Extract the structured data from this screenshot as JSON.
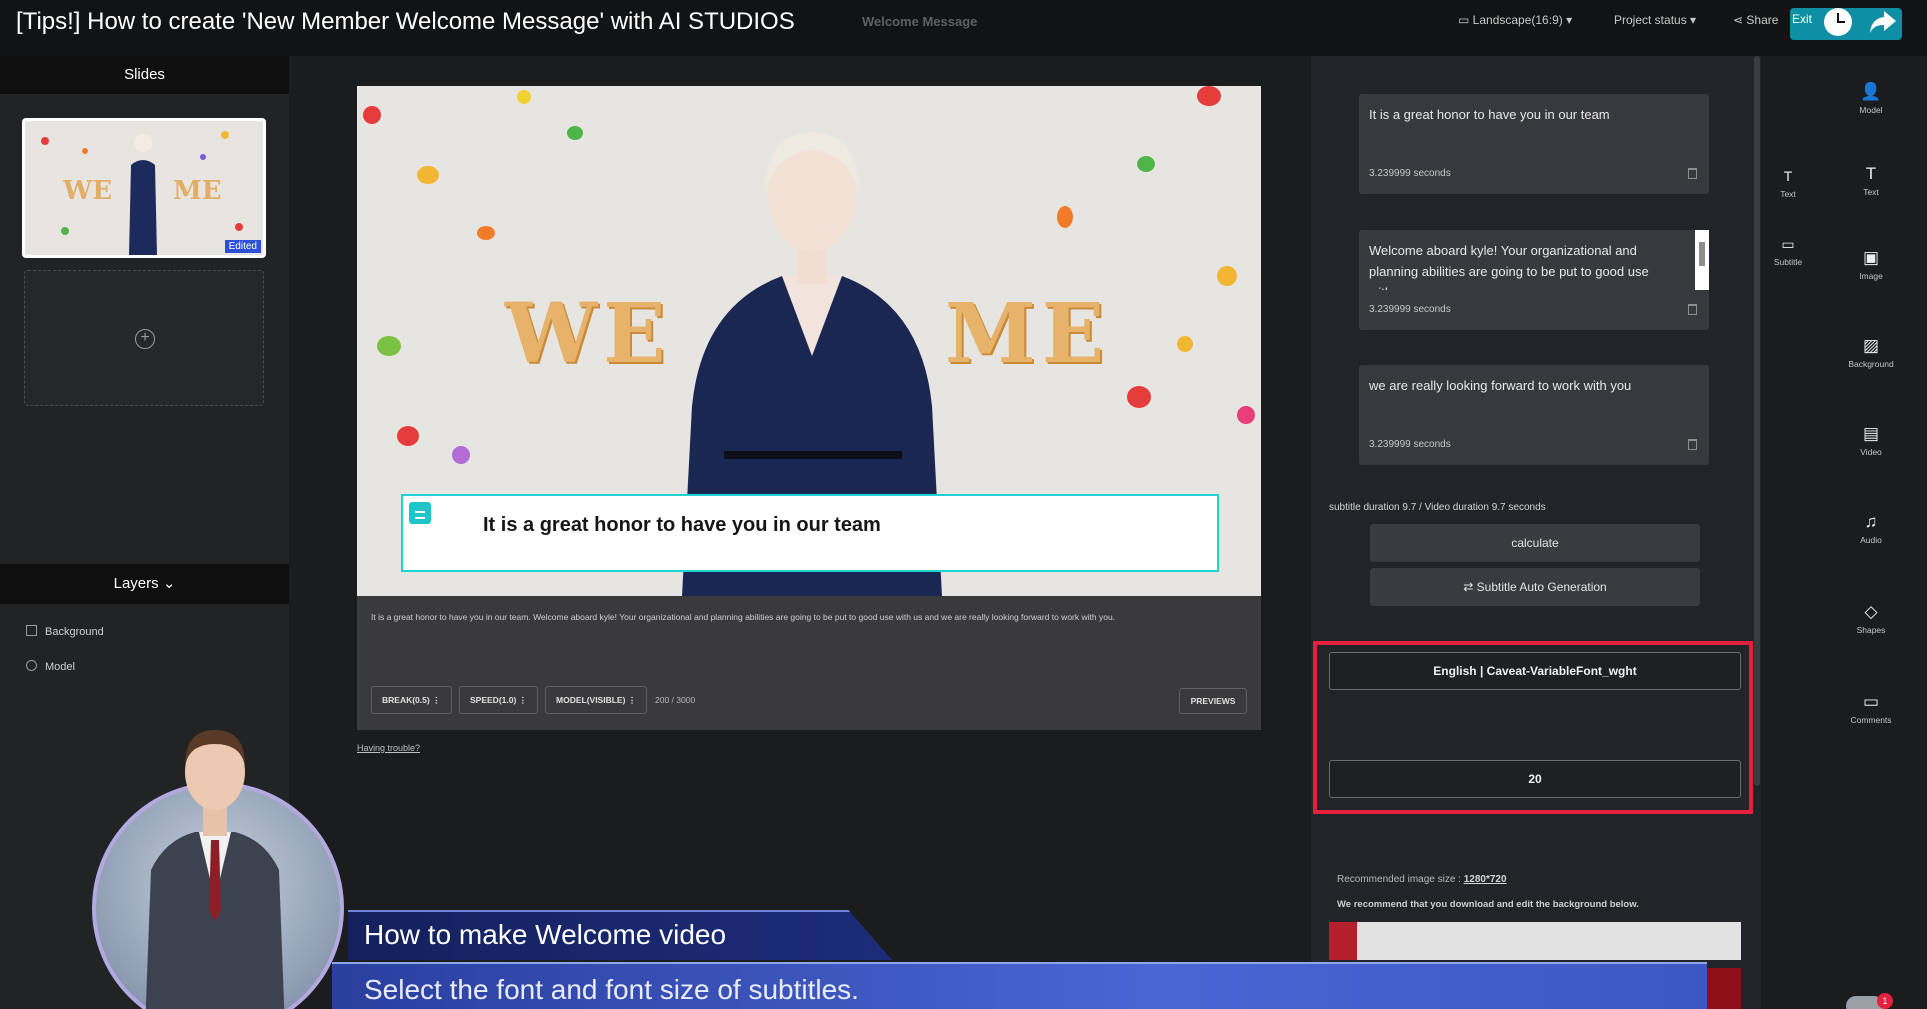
{
  "video_title": "[Tips!] How to create 'New Member Welcome Message' with AI STUDIOS",
  "header": {
    "document_title": "Welcome Message",
    "aspect": "Landscape(16:9)",
    "project_status": "Project status",
    "share": "Share",
    "exit": "Exit",
    "export": "Export"
  },
  "slides_panel": {
    "heading": "Slides",
    "thumb_badge": "Edited",
    "add_symbol": "+"
  },
  "layers_panel": {
    "heading": "Layers",
    "items": [
      "Background",
      "Model"
    ]
  },
  "canvas": {
    "backdrop_letters_left": "WE",
    "backdrop_letters_right": "ME",
    "subtitle": "It is a great honor to have you in our team"
  },
  "script": {
    "text": "It is a great honor to have you in our team. Welcome aboard kyle! Your organizational and planning abilities are going to be put to good use with us and we are really looking forward to work with you.",
    "chips": [
      "BREAK(0.5)",
      "SPEED(1.0)",
      "MODEL(VISIBLE)"
    ],
    "counter": "200 / 3000",
    "previews": "PREVIEWS",
    "trouble_link": "Having trouble?"
  },
  "subtitle_panel": {
    "cards": [
      {
        "text": "It is a great honor to have you in our team",
        "duration": "3.239999 seconds"
      },
      {
        "text": "Welcome aboard kyle! Your organizational and planning abilities are going to be put to good use with us",
        "duration": "3.239999 seconds"
      },
      {
        "text": "we are really looking forward to work with you",
        "duration": "3.239999 seconds"
      }
    ],
    "summary": "subtitle duration 9.7 / Video duration 9.7 seconds",
    "calculate": "calculate",
    "auto_generation": "⇄ Subtitle Auto Generation",
    "font_select": "English | Caveat-VariableFont_wght",
    "size_select": "20",
    "recommended_label": "Recommended image size : ",
    "recommended_value": "1280*720",
    "recommend_note": "We recommend that you download and edit the background below."
  },
  "mini_tools": [
    {
      "icon": "text-icon",
      "label": "Text"
    },
    {
      "icon": "subtitle-icon",
      "label": "Subtitle"
    }
  ],
  "icon_rail": [
    {
      "icon": "model-icon",
      "glyph": "👤",
      "label": "Model"
    },
    {
      "icon": "text-icon",
      "glyph": "T",
      "label": "Text"
    },
    {
      "icon": "image-icon",
      "glyph": "▣",
      "label": "Image"
    },
    {
      "icon": "background-icon",
      "glyph": "▨",
      "label": "Background"
    },
    {
      "icon": "video-icon",
      "glyph": "▤",
      "label": "Video"
    },
    {
      "icon": "audio-icon",
      "glyph": "♫",
      "label": "Audio"
    },
    {
      "icon": "shapes-icon",
      "glyph": "◇",
      "label": "Shapes"
    },
    {
      "icon": "comments-icon",
      "glyph": "▭",
      "label": "Comments"
    }
  ],
  "notification_count": "1",
  "lower_third": {
    "title": "How to make Welcome video",
    "subtitle": "Select the font and font size of subtitles."
  },
  "colors": {
    "accent_teal": "#1fd3d3",
    "highlight_red": "#e3213f",
    "banner_blue": "#3d57c2"
  }
}
